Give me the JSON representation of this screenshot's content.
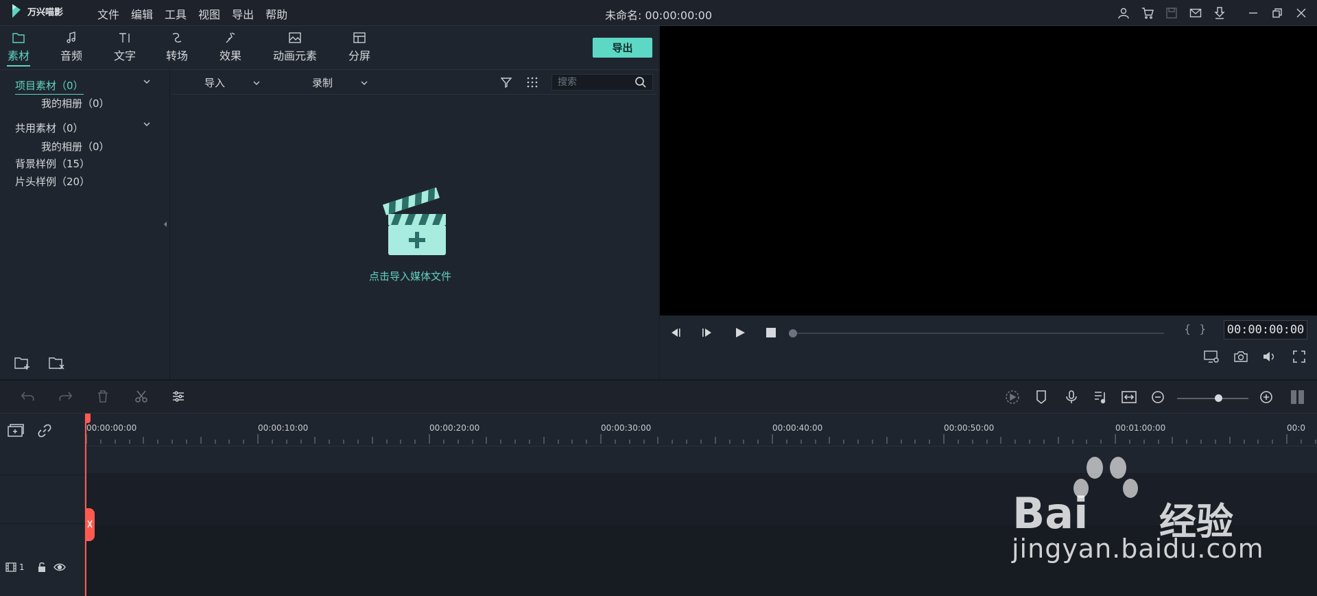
{
  "app": {
    "name": "万兴喵影",
    "doc_title": "未命名: 00:00:00:00",
    "menu": [
      "文件",
      "编辑",
      "工具",
      "视图",
      "导出",
      "帮助"
    ],
    "title_icons": [
      "user-icon",
      "cart-icon",
      "save-icon",
      "mail-icon",
      "download-icon",
      "minimize-icon",
      "restore-icon",
      "close-icon"
    ]
  },
  "library": {
    "tabs": [
      {
        "label": "素材",
        "icon": "folder-icon",
        "active": true
      },
      {
        "label": "音频",
        "icon": "music-icon"
      },
      {
        "label": "文字",
        "icon": "text-icon"
      },
      {
        "label": "转场",
        "icon": "transition-icon"
      },
      {
        "label": "效果",
        "icon": "effect-icon"
      },
      {
        "label": "动画元素",
        "icon": "image-icon"
      },
      {
        "label": "分屏",
        "icon": "split-screen-icon"
      }
    ],
    "export_label": "导出",
    "tree": [
      {
        "label": "项目素材（0）",
        "active": true
      },
      {
        "label": "我的相册（0）"
      },
      {
        "label": "共用素材（0）"
      },
      {
        "label": "我的相册（0）"
      },
      {
        "label": "背景样例（15）"
      },
      {
        "label": "片头样例（20）"
      }
    ],
    "toolbar": {
      "import_label": "导入",
      "record_label": "录制",
      "search_placeholder": "搜索"
    },
    "import_hint": "点击导入媒体文件"
  },
  "preview": {
    "timecode": "00:00:00:00",
    "bracket_in": "{",
    "bracket_out": "}"
  },
  "timeline": {
    "ruler_labels": [
      "00:00:00:00",
      "00:00:10:00",
      "00:00:20:00",
      "00:00:30:00",
      "00:00:40:00",
      "00:00:50:00",
      "00:01:00:00",
      "00:0"
    ],
    "track_number": "1"
  },
  "watermark": {
    "brand": "Bai",
    "brand_cn": "经验",
    "url": "jingyan.baidu.com"
  },
  "colors": {
    "accent": "#5fd3c3",
    "playhead": "#ff5a4f",
    "background": "#1b2029"
  }
}
